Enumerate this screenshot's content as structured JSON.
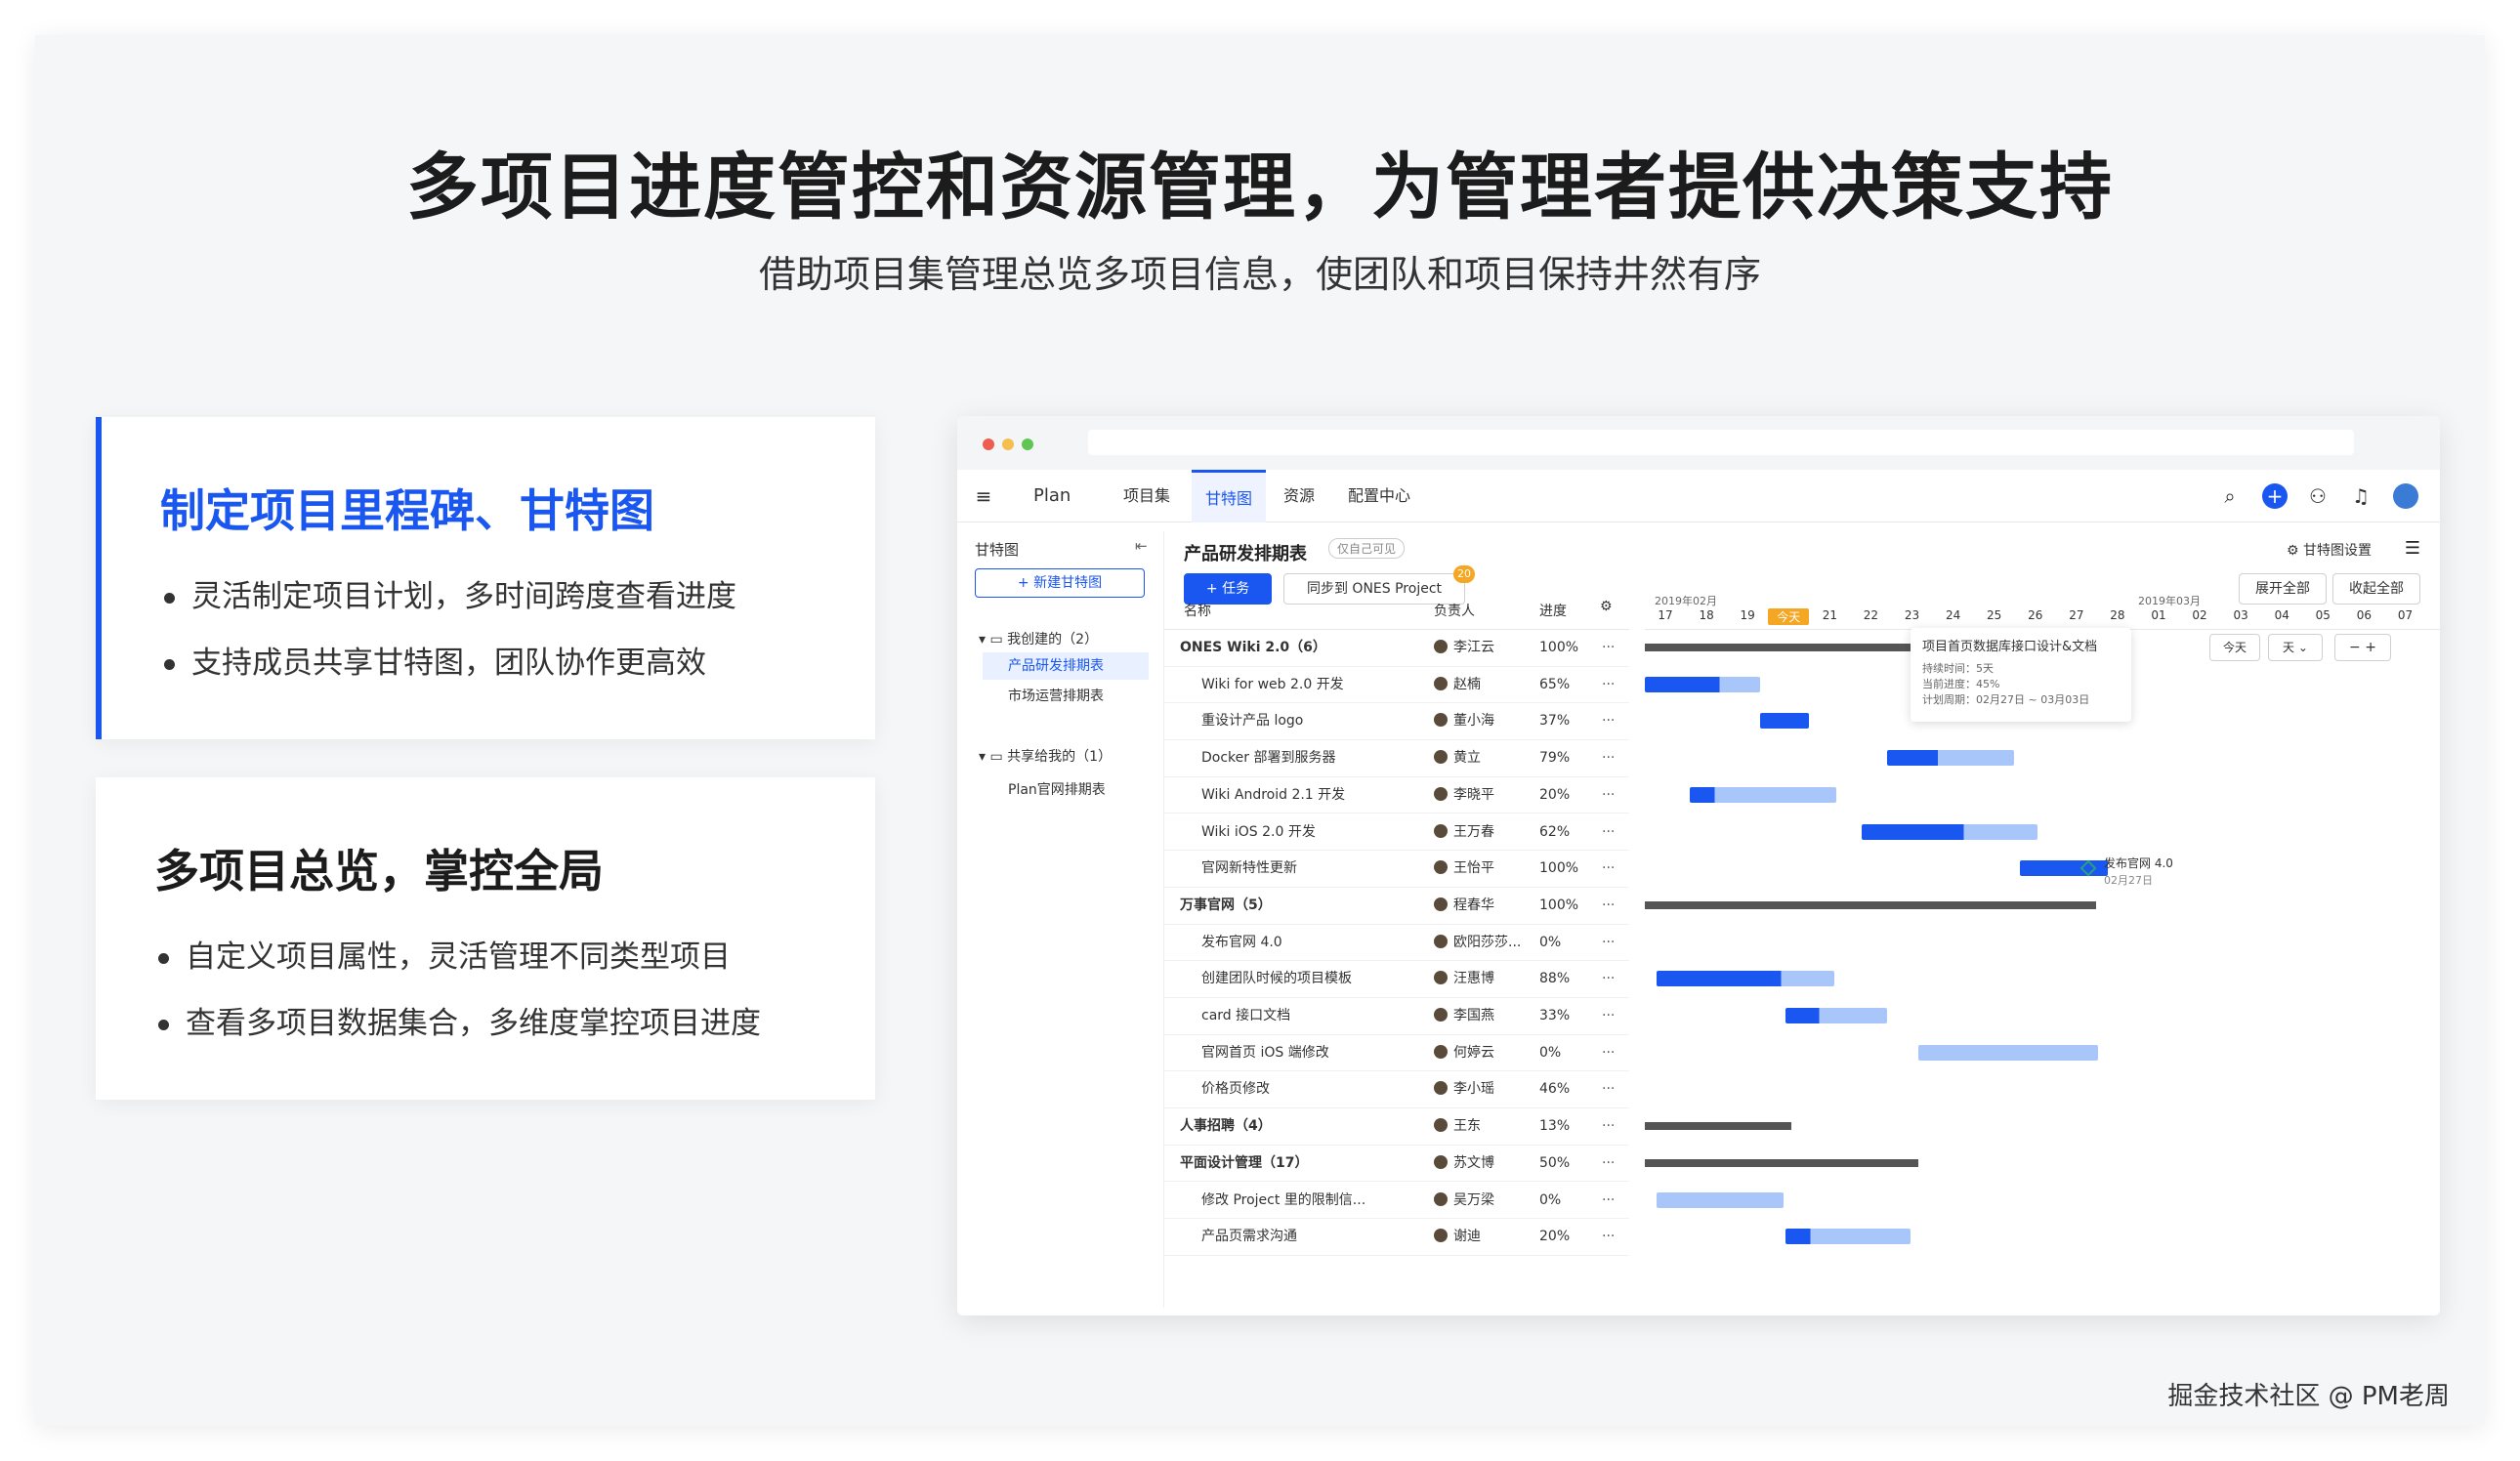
{
  "hero": {
    "title": "多项目进度管控和资源管理，为管理者提供决策支持",
    "subtitle": "借助项目集管理总览多项目信息，使团队和项目保持井然有序"
  },
  "card1": {
    "title": "制定项目里程碑、甘特图",
    "bullets": [
      "灵活制定项目计划，多时间跨度查看进度",
      "支持成员共享甘特图，团队协作更高效"
    ]
  },
  "card2": {
    "title": "多项目总览，掌控全局",
    "bullets": [
      "自定义项目属性，灵活管理不同类型项目",
      "查看多项目数据集合，多维度掌控项目进度"
    ]
  },
  "app": {
    "nav": {
      "menu_icon": "menu-collapse-icon",
      "brand": "Plan",
      "tabs": [
        "项目集",
        "甘特图",
        "资源",
        "配置中心"
      ],
      "active_tab": "甘特图",
      "right_icons": [
        "search-icon",
        "add-icon",
        "add-user-icon",
        "bell-icon",
        "avatar"
      ]
    },
    "sidebar": {
      "title": "甘特图",
      "new_button": "+ 新建甘特图",
      "group1": "我创建的（2）",
      "group1_items": [
        "产品研发排期表",
        "市场运营排期表"
      ],
      "group2": "共享给我的（1）",
      "group2_items": [
        "Plan官网排期表"
      ]
    },
    "main": {
      "title": "产品研发排期表",
      "visibility_tag": "仅自己可见",
      "settings": "甘特图设置",
      "task_button": "+ 任务",
      "sync_button": "同步到 ONES Project",
      "sync_badge": "20",
      "expand_all": "展开全部",
      "collapse_all": "收起全部",
      "today_button": "今天",
      "scale_select": "天",
      "columns": [
        "名称",
        "负责人",
        "进度"
      ],
      "month_labels": [
        "2019年02月",
        "2019年03月"
      ],
      "days": [
        "17",
        "18",
        "19",
        "今天",
        "21",
        "22",
        "23",
        "24",
        "25",
        "26",
        "27",
        "28",
        "01",
        "02",
        "03",
        "04",
        "05",
        "06",
        "07"
      ],
      "rows": [
        {
          "name": "ONES Wiki 2.0（6）",
          "owner": "李江云",
          "progress": "100%",
          "level": 0
        },
        {
          "name": "Wiki for web 2.0 开发",
          "owner": "赵楠",
          "progress": "65%",
          "level": 1
        },
        {
          "name": "重设计产品 logo",
          "owner": "董小海",
          "progress": "37%",
          "level": 1
        },
        {
          "name": "Docker 部署到服务器",
          "owner": "黄立",
          "progress": "79%",
          "level": 1
        },
        {
          "name": "Wiki Android 2.1 开发",
          "owner": "李晓平",
          "progress": "20%",
          "level": 1
        },
        {
          "name": "Wiki iOS 2.0 开发",
          "owner": "王万春",
          "progress": "62%",
          "level": 1
        },
        {
          "name": "官网新特性更新",
          "owner": "王怡平",
          "progress": "100%",
          "level": 1
        },
        {
          "name": "万事官网（5）",
          "owner": "程春华",
          "progress": "100%",
          "level": 0
        },
        {
          "name": "发布官网 4.0",
          "owner": "欧阳莎莎...",
          "progress": "0%",
          "level": 1
        },
        {
          "name": "创建团队时候的项目模板",
          "owner": "汪惠博",
          "progress": "88%",
          "level": 1
        },
        {
          "name": "card 接口文档",
          "owner": "李国燕",
          "progress": "33%",
          "level": 1
        },
        {
          "name": "官网首页 iOS 端修改",
          "owner": "何婷云",
          "progress": "0%",
          "level": 1
        },
        {
          "name": "价格页修改",
          "owner": "李小瑶",
          "progress": "46%",
          "level": 1
        },
        {
          "name": "人事招聘（4）",
          "owner": "王东",
          "progress": "13%",
          "level": 0
        },
        {
          "name": "平面设计管理（17）",
          "owner": "苏文博",
          "progress": "50%",
          "level": 0
        },
        {
          "name": "修改 Project 里的限制信...",
          "owner": "吴万梁",
          "progress": "0%",
          "level": 1
        },
        {
          "name": "产品页需求沟通",
          "owner": "谢迪",
          "progress": "20%",
          "level": 1
        }
      ],
      "tooltip": {
        "title": "项目首页数据库接口设计&文档",
        "duration": "持续时间：5天",
        "progress": "当前进度：45%",
        "period": "计划周期：02月27日 ~ 03月03日"
      },
      "milestone": {
        "label": "发布官网 4.0",
        "date": "02月27日"
      }
    }
  },
  "watermark": "掘金技术社区 @ PM老周",
  "colors": {
    "accent": "#1a56f0",
    "bar_light": "#a9c6fb",
    "summary": "#555555"
  }
}
